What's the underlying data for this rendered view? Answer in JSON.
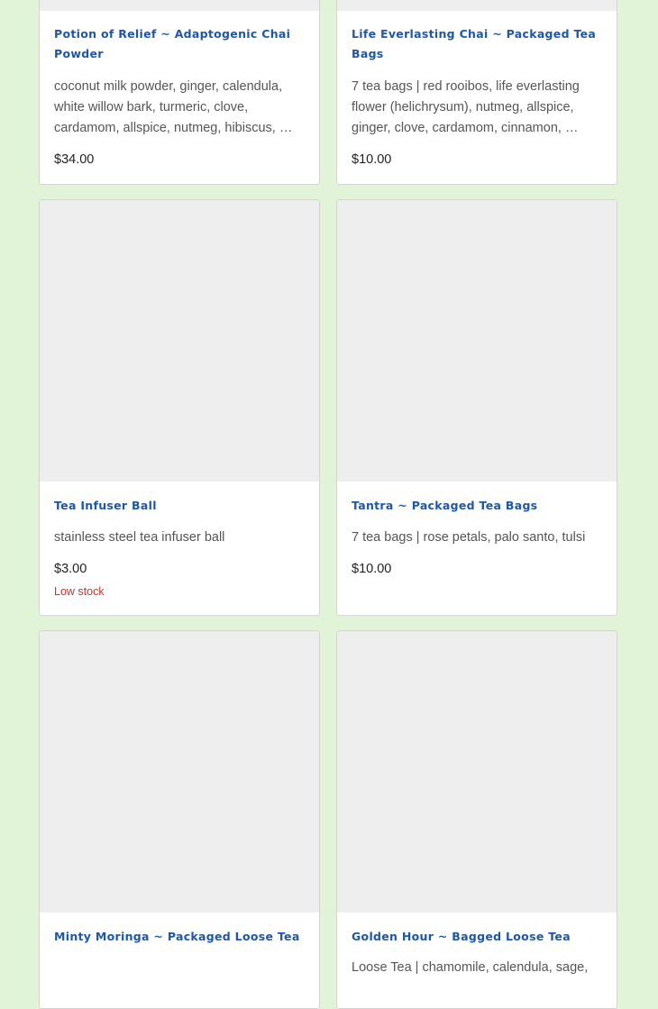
{
  "products": [
    {
      "title": "Potion of Relief ~ Adaptogenic Chai Powder",
      "description": "coconut milk powder, ginger, calendula, white willow bark, turmeric, clove, cardamom, allspice, nutmeg, hibiscus, …",
      "price": "$34.00"
    },
    {
      "title": "Life Everlasting Chai ~ Packaged Tea Bags",
      "description": "7 tea bags | red rooibos, life everlasting flower (helichrysum), nutmeg, allspice, ginger, clove, cardamom, cinnamon, …",
      "price": "$10.00"
    },
    {
      "title": "Tea Infuser Ball",
      "description": "stainless steel tea infuser ball",
      "price": "$3.00",
      "stock": "Low stock"
    },
    {
      "title": "Tantra ~ Packaged Tea Bags",
      "description": "7 tea bags | rose petals, palo santo, tulsi",
      "price": "$10.00"
    },
    {
      "title": "Minty Moringa ~ Packaged Loose Tea",
      "description": ""
    },
    {
      "title": "Golden Hour ~ Bagged Loose Tea",
      "description": "Loose Tea | chamomile, calendula, sage,"
    }
  ],
  "colors": {
    "page_background": "#e1f4d7",
    "title": "#1e57a8",
    "image_placeholder": "#eeeeee",
    "low_stock": "#c9302c"
  }
}
